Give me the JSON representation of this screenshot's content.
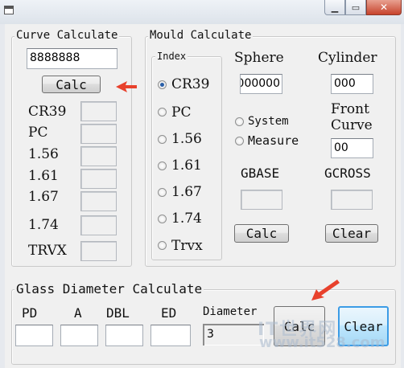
{
  "window": {
    "minimize_glyph": "▁",
    "maximize_glyph": "▭",
    "close_glyph": "✕"
  },
  "curve": {
    "legend": "Curve Calculate",
    "input_value": "8888888",
    "calc_label": "Calc",
    "rows": [
      {
        "label": "CR39"
      },
      {
        "label": "PC"
      },
      {
        "label": "1.56"
      },
      {
        "label": "1.61"
      },
      {
        "label": "1.67"
      },
      {
        "label": "1.74"
      },
      {
        "label": "TRVX"
      }
    ]
  },
  "mould": {
    "legend": "Mould Calculate",
    "index_legend": "Index",
    "index_options": [
      {
        "label": "CR39",
        "selected": true
      },
      {
        "label": "PC",
        "selected": false
      },
      {
        "label": "1.56",
        "selected": false
      },
      {
        "label": "1.61",
        "selected": false
      },
      {
        "label": "1.67",
        "selected": false
      },
      {
        "label": "1.74",
        "selected": false
      },
      {
        "label": "Trvx",
        "selected": false
      }
    ],
    "sphere_label": "Sphere",
    "sphere_value": "000000",
    "cylinder_label": "Cylinder",
    "cylinder_value": "000",
    "front_curve_label_1": "Front",
    "front_curve_label_2": "Curve",
    "front_curve_value": "00",
    "mode_system": "System",
    "mode_measure": "Measure",
    "gbase_label": "GBASE",
    "gcross_label": "GCROSS",
    "calc_label": "Calc",
    "clear_label": "Clear"
  },
  "glass": {
    "legend": "Glass Diameter Calculate",
    "pd_label": "PD",
    "a_label": "A",
    "dbl_label": "DBL",
    "ed_label": "ED",
    "diameter_label": "Diameter",
    "diameter_value": "3",
    "calc_label": "Calc",
    "clear_label": "Clear"
  },
  "watermark": {
    "line1": "IT世界网",
    "line2": "www.it528.com"
  },
  "colors": {
    "arrow": "#e8412c",
    "focus_border": "#3c9ce6"
  }
}
